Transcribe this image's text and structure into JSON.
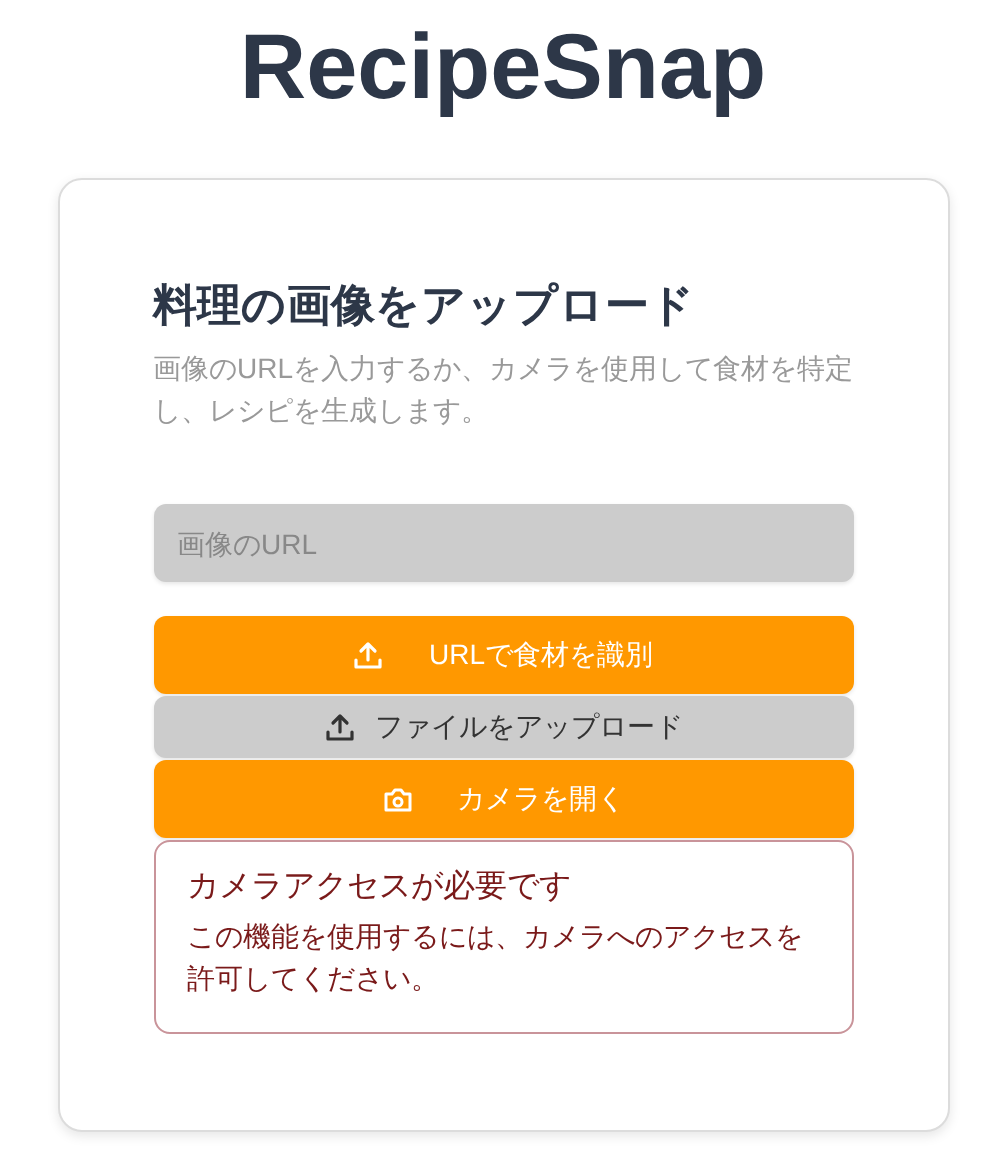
{
  "app_title": "RecipeSnap",
  "card": {
    "heading": "料理の画像をアップロード",
    "description": "画像のURLを入力するか、カメラを使用して食材を特定し、レシピを生成します。",
    "url_field": {
      "placeholder": "画像のURL"
    },
    "buttons": [
      {
        "label": "URLで食材を識別",
        "kind": "identify"
      },
      {
        "label": "ファイルをアップロード",
        "kind": "upload"
      },
      {
        "label": "カメラを開く",
        "kind": "camera"
      }
    ],
    "alert": {
      "title": "カメラアクセスが必要です",
      "message": "この機能を使用するには、カメラへのアクセスを許可してください。"
    }
  }
}
